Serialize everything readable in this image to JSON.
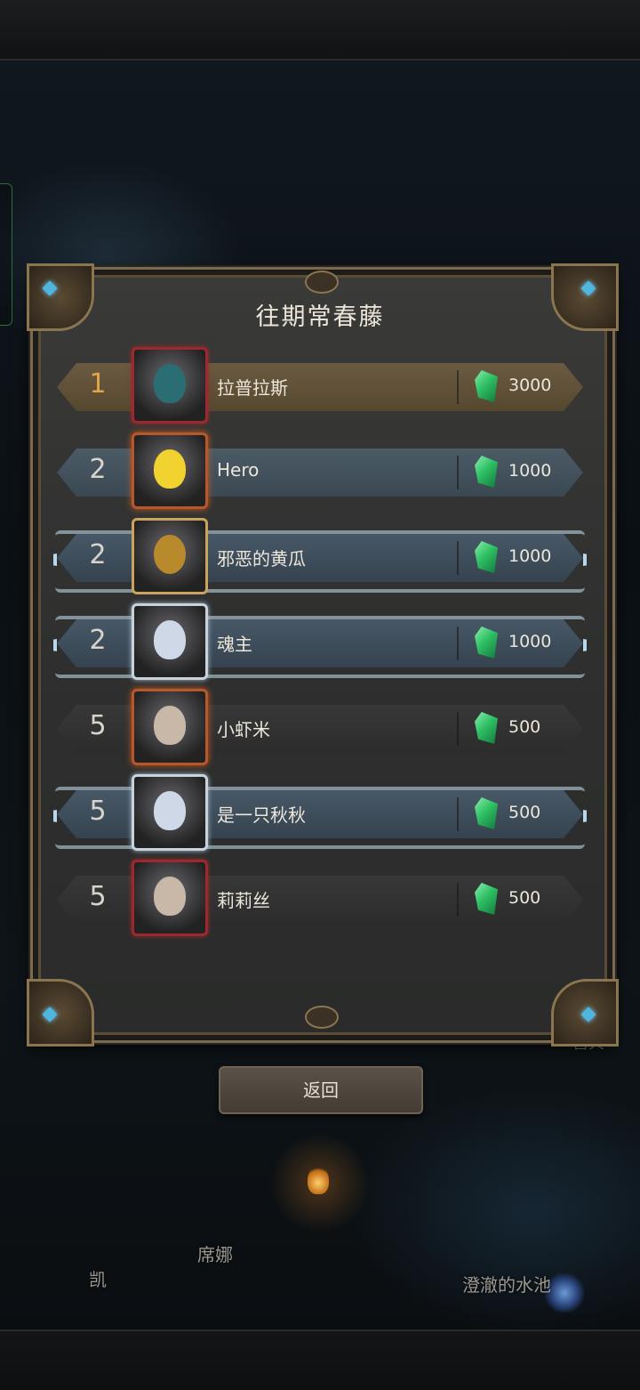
{
  "title": "往期常春藤",
  "back_button": "返回",
  "map_labels": {
    "kai": "凯",
    "xina": "席娜",
    "pool": "澄澈的水池",
    "beacon": "营火"
  },
  "rankings": [
    {
      "rank": "1",
      "name": "拉普拉斯",
      "reward": "3000",
      "style": "gold",
      "frame": "crimson"
    },
    {
      "rank": "2",
      "name": "Hero",
      "reward": "1000",
      "style": "blue",
      "frame": "fire"
    },
    {
      "rank": "2",
      "name": "邪恶的黄瓜",
      "reward": "1000",
      "style": "frost",
      "frame": "gold"
    },
    {
      "rank": "2",
      "name": "魂主",
      "reward": "1000",
      "style": "frost",
      "frame": "silver"
    },
    {
      "rank": "5",
      "name": "小虾米",
      "reward": "500",
      "style": "dark",
      "frame": "fire"
    },
    {
      "rank": "5",
      "name": "是一只秋秋",
      "reward": "500",
      "style": "frost",
      "frame": "silver"
    },
    {
      "rank": "5",
      "name": "莉莉丝",
      "reward": "500",
      "style": "dark",
      "frame": "crimson"
    }
  ],
  "colors": {
    "gold_rank": "#e0a54a",
    "gem": "#2fbf64",
    "frame": "#7b6a4e"
  },
  "icons": {
    "reward": "green-gem-icon"
  }
}
